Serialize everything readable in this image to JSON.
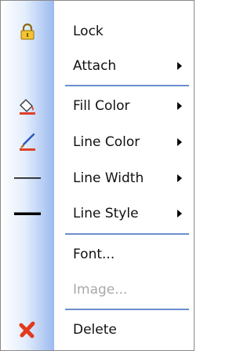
{
  "menu": {
    "items": [
      {
        "label": "Lock",
        "icon": "lock-icon"
      },
      {
        "label": "Attach",
        "submenu": true
      },
      {
        "label": "Fill Color",
        "icon": "fill-color-icon",
        "submenu": true
      },
      {
        "label": "Line Color",
        "icon": "line-color-icon",
        "submenu": true
      },
      {
        "label": "Line Width",
        "icon": "line-width-icon",
        "submenu": true
      },
      {
        "label": "Line Style",
        "icon": "line-style-icon",
        "submenu": true
      },
      {
        "label": "Font..."
      },
      {
        "label": "Image...",
        "disabled": true
      },
      {
        "label": "Delete",
        "icon": "delete-icon"
      }
    ]
  },
  "colors": {
    "separator": "#6b8ed0",
    "gutter_gradient_end": "#9cbaf0",
    "disabled_text": "#a9a9a9",
    "delete_icon": "#e23a1e"
  }
}
